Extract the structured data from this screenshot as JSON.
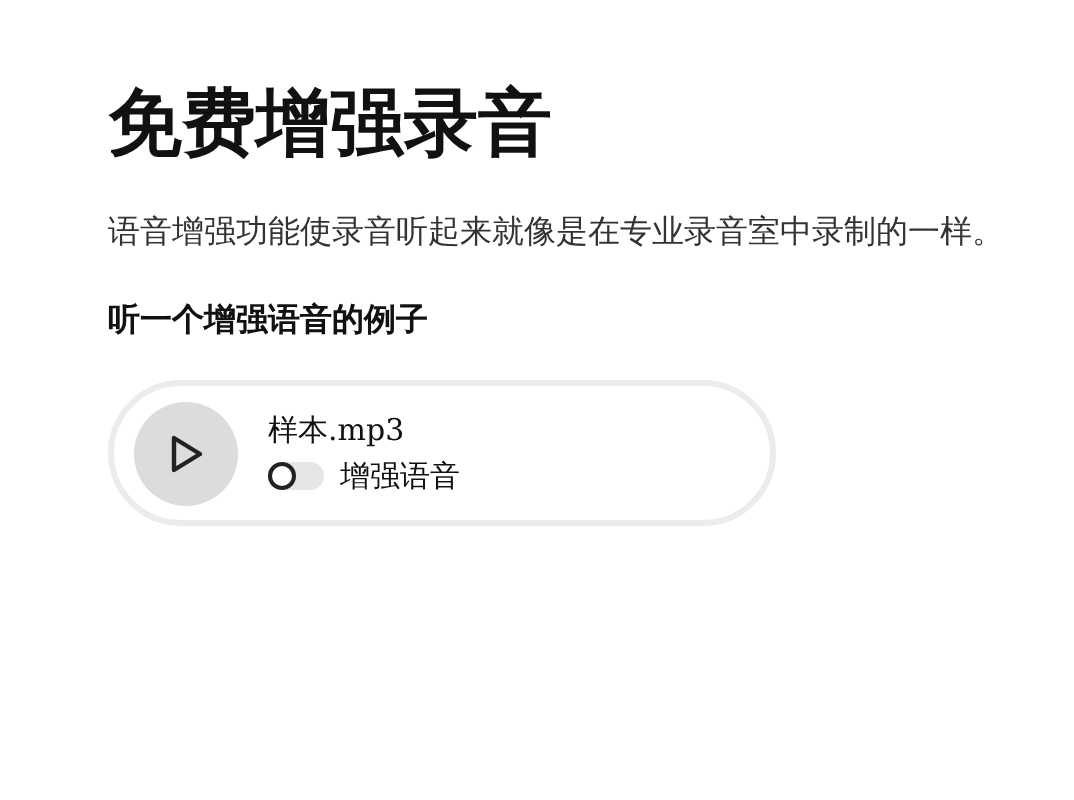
{
  "title": "免费增强录音",
  "description": "语音增强功能使录音听起来就像是在专业录音室中录制的一样。",
  "example_heading": "听一个增强语音的例子",
  "player": {
    "filename": "样本.mp3",
    "toggle": {
      "label": "增强语音",
      "on": false
    }
  }
}
